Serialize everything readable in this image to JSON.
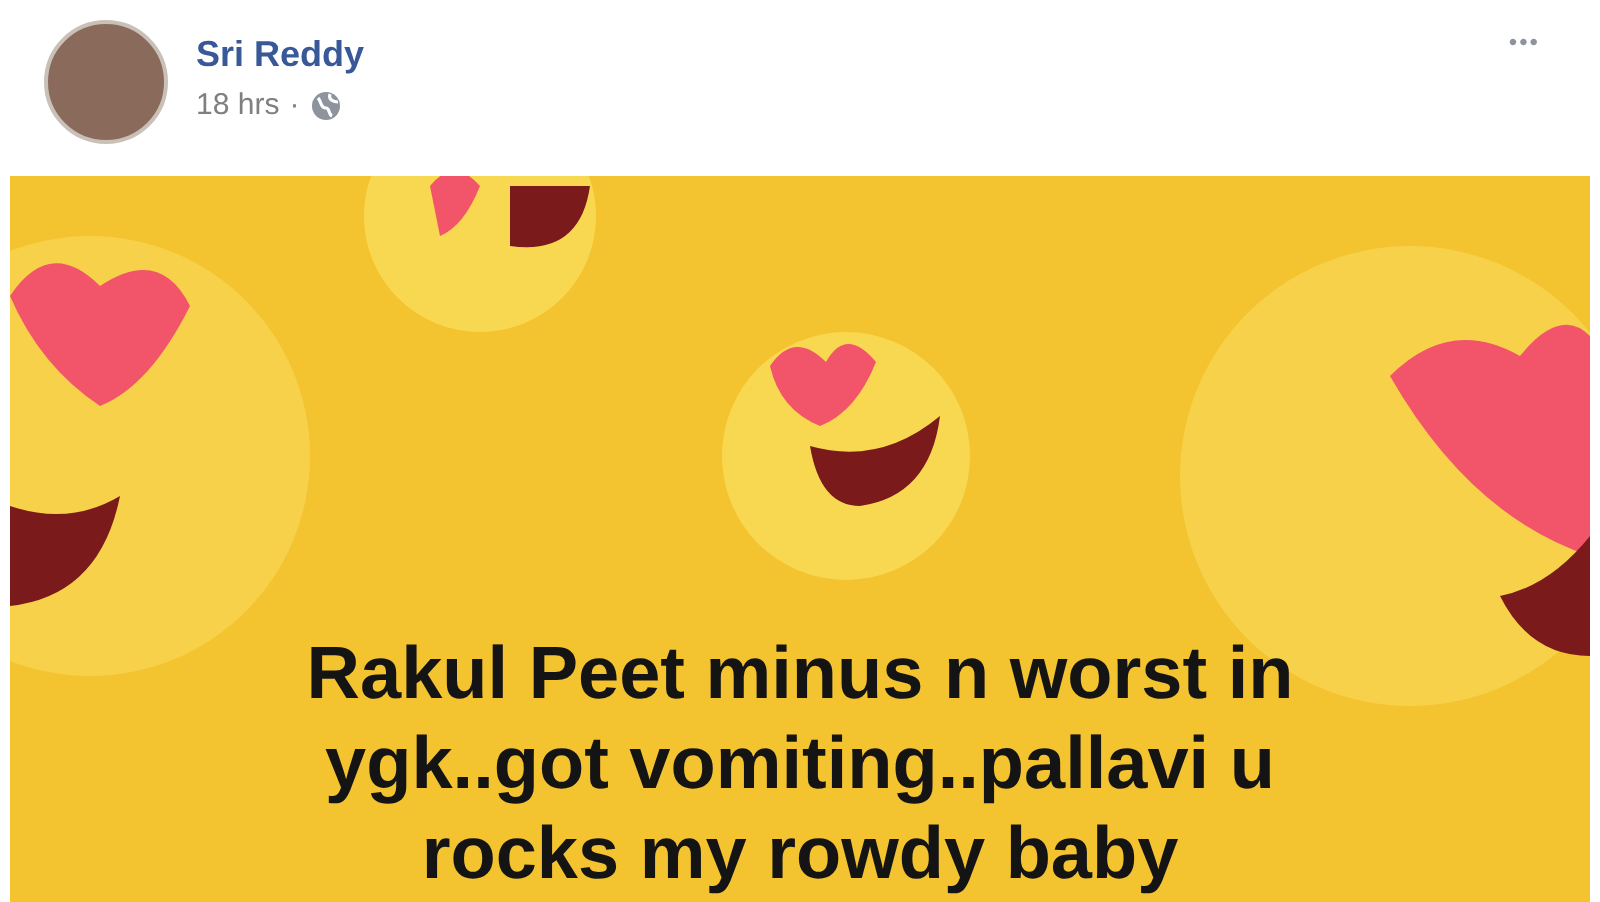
{
  "post": {
    "author": "Sri Reddy",
    "time": "18 hrs",
    "separator": "·",
    "menu": "•••",
    "image_text_lines": [
      "Rakul Peet minus n worst in",
      "ygk..got vomiting..pallavi u",
      "rocks my rowdy baby"
    ]
  }
}
